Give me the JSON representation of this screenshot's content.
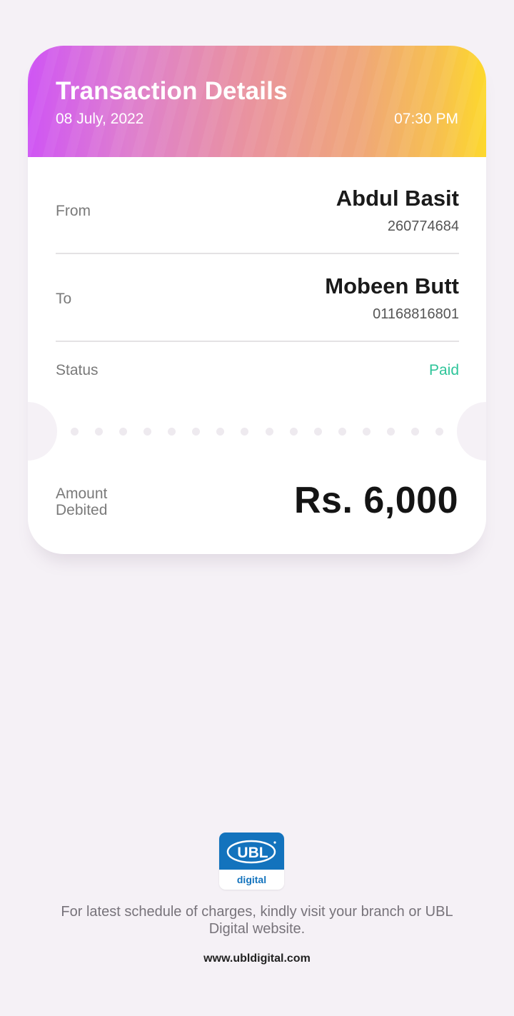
{
  "header": {
    "title": "Transaction Details",
    "date": "08 July, 2022",
    "time": "07:30 PM"
  },
  "from": {
    "label": "From",
    "name": "Abdul Basit",
    "account": "260774684"
  },
  "to": {
    "label": "To",
    "name": "Mobeen Butt",
    "account": "01168816801"
  },
  "status": {
    "label": "Status",
    "value": "Paid"
  },
  "amount": {
    "label_line1": "Amount",
    "label_line2": "Debited",
    "value": "Rs. 6,000"
  },
  "logo": {
    "brand": "UBL",
    "sub": "digital"
  },
  "footer": {
    "note": "For latest schedule of charges, kindly visit your branch or UBL Digital website.",
    "url": "www.ubldigital.com"
  },
  "colors": {
    "status_paid": "#2fc59a",
    "brand_blue": "#1373bd",
    "header_gradient_start": "#cf55f4",
    "header_gradient_end": "#fdd82c"
  }
}
